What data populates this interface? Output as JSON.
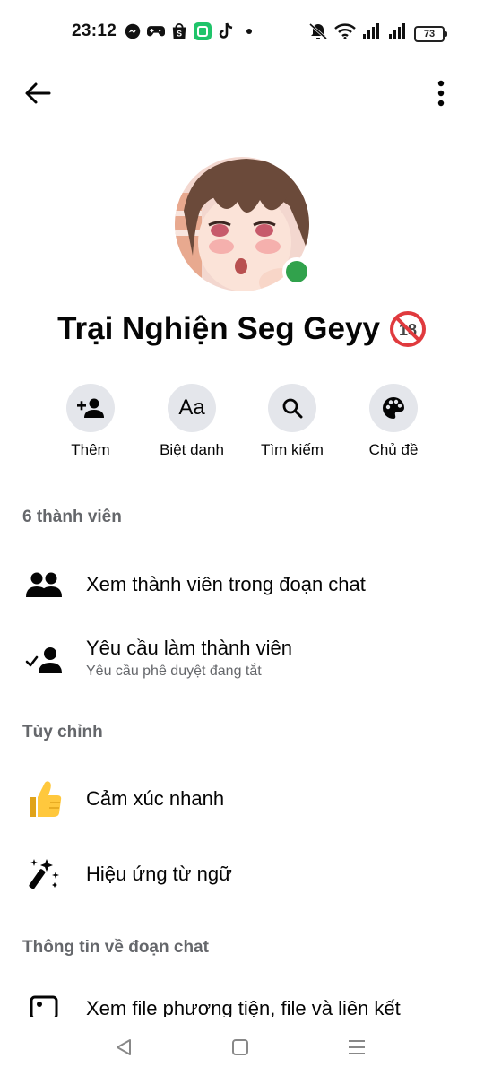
{
  "status_bar": {
    "time": "23:12",
    "battery": "73",
    "notification_icons": [
      "messenger-icon",
      "game-controller-icon",
      "shopee-icon",
      "green-app-icon",
      "tiktok-icon",
      "dot-icon"
    ],
    "right_icons": [
      "mute-icon",
      "wifi-icon",
      "signal-icon",
      "signal-icon",
      "battery-icon"
    ]
  },
  "header": {
    "back_icon": "arrow-left-icon",
    "more_icon": "more-vertical-icon"
  },
  "profile": {
    "group_name": "Trại Nghiện Seg Geyy",
    "badge": "18",
    "online_color": "#31a24c"
  },
  "actions": [
    {
      "label": "Thêm",
      "icon": "add-person-icon"
    },
    {
      "label": "Biệt danh",
      "icon": "Aa"
    },
    {
      "label": "Tìm kiếm",
      "icon": "search-icon"
    },
    {
      "label": "Chủ đề",
      "icon": "palette-icon"
    }
  ],
  "sections": {
    "members": {
      "title": "6 thành viên",
      "items": [
        {
          "title": "Xem thành viên trong đoạn chat",
          "icon": "people-icon"
        },
        {
          "title": "Yêu cầu làm thành viên",
          "subtitle": "Yêu cầu phê duyệt đang tắt",
          "icon": "person-check-icon"
        }
      ]
    },
    "customize": {
      "title": "Tùy chỉnh",
      "items": [
        {
          "title": "Cảm xúc nhanh",
          "icon": "thumbs-up-icon"
        },
        {
          "title": "Hiệu ứng từ ngữ",
          "icon": "magic-wand-icon"
        }
      ]
    },
    "chat_info": {
      "title": "Thông tin về đoạn chat",
      "items": [
        {
          "title": "Xem file phương tiện, file và liên kết",
          "icon": "image-icon"
        }
      ]
    }
  },
  "colors": {
    "accent_green": "#31a24c",
    "secondary_text": "#65676b",
    "button_bg": "#e4e6eb"
  }
}
